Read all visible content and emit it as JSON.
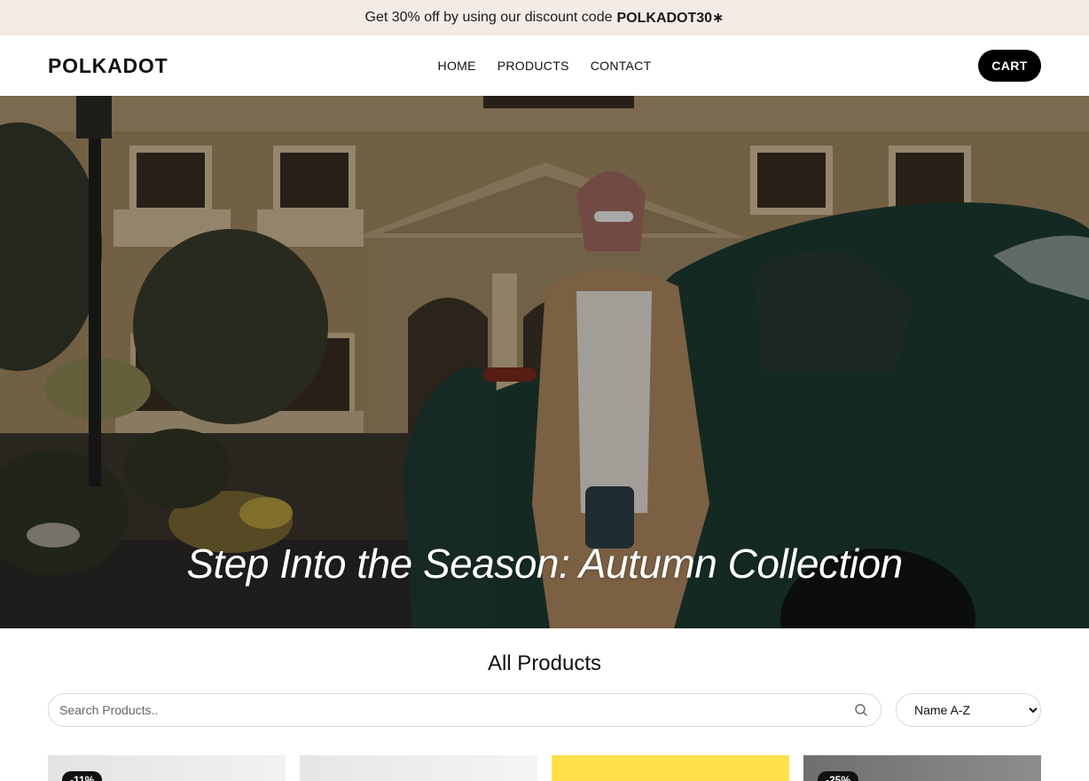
{
  "announcement": {
    "text": "Get 30% off by using our discount code",
    "code": "POLKADOT30∗"
  },
  "header": {
    "logo": "POLKADOT",
    "nav": [
      "HOME",
      "PRODUCTS",
      "CONTACT"
    ],
    "cart_label": "CART"
  },
  "hero": {
    "title": "Step Into the Season: Autumn Collection"
  },
  "products": {
    "title": "All Products",
    "search_placeholder": "Search Products..",
    "sort_options": [
      "Name A-Z"
    ],
    "sort_selected": "Name A-Z",
    "cards": [
      {
        "badge": "-11%",
        "bg": "#e9e9e9"
      },
      {
        "badge": "",
        "bg": "#ececec"
      },
      {
        "badge": "",
        "bg": "#fde04a"
      },
      {
        "badge": "-25%",
        "bg": "#7e7e7e"
      }
    ]
  }
}
